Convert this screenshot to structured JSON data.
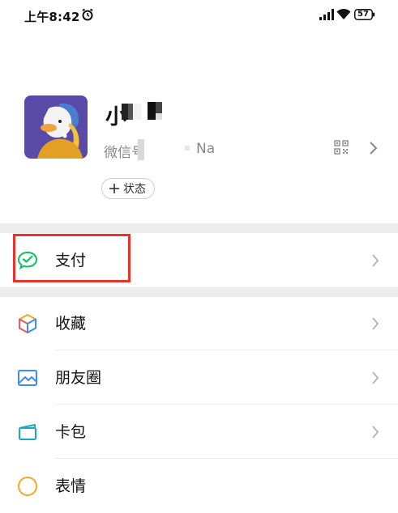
{
  "status_bar": {
    "time": "上午8:42",
    "battery": "57"
  },
  "profile": {
    "nickname_visible": "小",
    "wechat_id_prefix": "微信号",
    "wechat_id_suffix": "Na",
    "status_button_label": "状态"
  },
  "menu": {
    "items": [
      {
        "label": "支付",
        "icon": "wechat-pay-icon"
      },
      {
        "label": "收藏",
        "icon": "favorites-cube-icon"
      },
      {
        "label": "朋友圈",
        "icon": "moments-image-icon"
      },
      {
        "label": "卡包",
        "icon": "card-wallet-icon"
      },
      {
        "label": "表情",
        "icon": "emoji-icon"
      }
    ]
  },
  "colors": {
    "highlight": "#e8322b",
    "pay_green": "#07c160",
    "section_gap": "#ededed"
  }
}
